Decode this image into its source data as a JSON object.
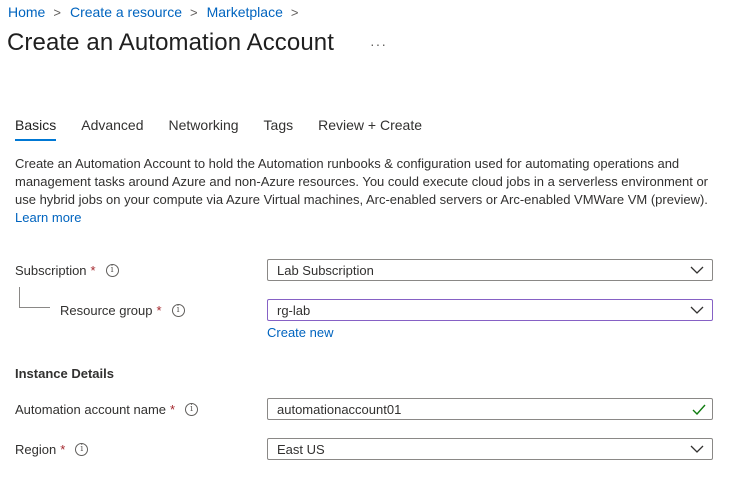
{
  "breadcrumb": {
    "items": [
      "Home",
      "Create a resource",
      "Marketplace"
    ],
    "separator": ">"
  },
  "page": {
    "title": "Create an Automation Account",
    "more_label": "···"
  },
  "tabs": [
    {
      "label": "Basics",
      "active": true
    },
    {
      "label": "Advanced",
      "active": false
    },
    {
      "label": "Networking",
      "active": false
    },
    {
      "label": "Tags",
      "active": false
    },
    {
      "label": "Review + Create",
      "active": false
    }
  ],
  "description": {
    "text": "Create an Automation Account to hold the Automation runbooks & configuration used for automating operations and management tasks around Azure and non-Azure resources. You could execute cloud jobs in a serverless environment or use hybrid jobs on your compute via Azure Virtual machines, Arc-enabled servers or Arc-enabled VMWare VM (preview).",
    "link": "Learn more"
  },
  "form": {
    "required_mark": "*",
    "info_glyph": "i",
    "subscription": {
      "label": "Subscription",
      "value": "Lab Subscription"
    },
    "resource_group": {
      "label": "Resource group",
      "value": "rg-lab",
      "create_new": "Create new"
    },
    "instance_details_heading": "Instance Details",
    "account_name": {
      "label": "Automation account name",
      "value": "automationaccount01"
    },
    "region": {
      "label": "Region",
      "value": "East US"
    }
  },
  "colors": {
    "link": "#0064bf",
    "accent": "#0078d4",
    "required": "#a4262c",
    "focus_border": "#8661c5",
    "valid_check": "#107c10"
  }
}
